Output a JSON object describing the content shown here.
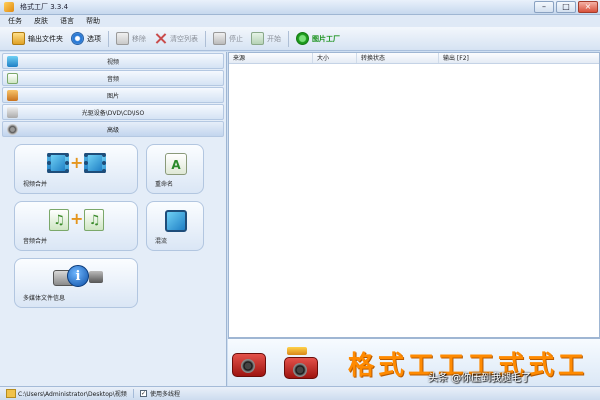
{
  "window": {
    "title": "格式工厂 3.3.4"
  },
  "menu": [
    "任务",
    "皮肤",
    "语言",
    "帮助"
  ],
  "toolbar": {
    "output_folder": "输出文件夹",
    "options": "选项",
    "remove": "移除",
    "clear_list": "清空列表",
    "stop": "停止",
    "start": "开始",
    "shop": "图片工厂"
  },
  "categories": [
    "视频",
    "音频",
    "图片",
    "光驱设备\\DVD\\CD\\ISO",
    "高级"
  ],
  "advanced_tiles": {
    "video_merge": "视频合并",
    "rename": "重命名",
    "audio_merge": "音频合并",
    "mix": "混流",
    "media_info": "多媒体文件信息"
  },
  "task_columns": [
    "来源",
    "大小",
    "转换状态",
    "输出 [F2]"
  ],
  "banner": {
    "brand_text": "格式工工工式式工",
    "watermark": "头条 @你压到我腿毛了"
  },
  "status": {
    "path": "C:\\Users\\Administrator\\Desktop\\视频",
    "multithread": "使用多线程"
  },
  "colors": {
    "accent": "#ff8a00",
    "panel": "#e4edf8",
    "shop": "#18911b"
  }
}
